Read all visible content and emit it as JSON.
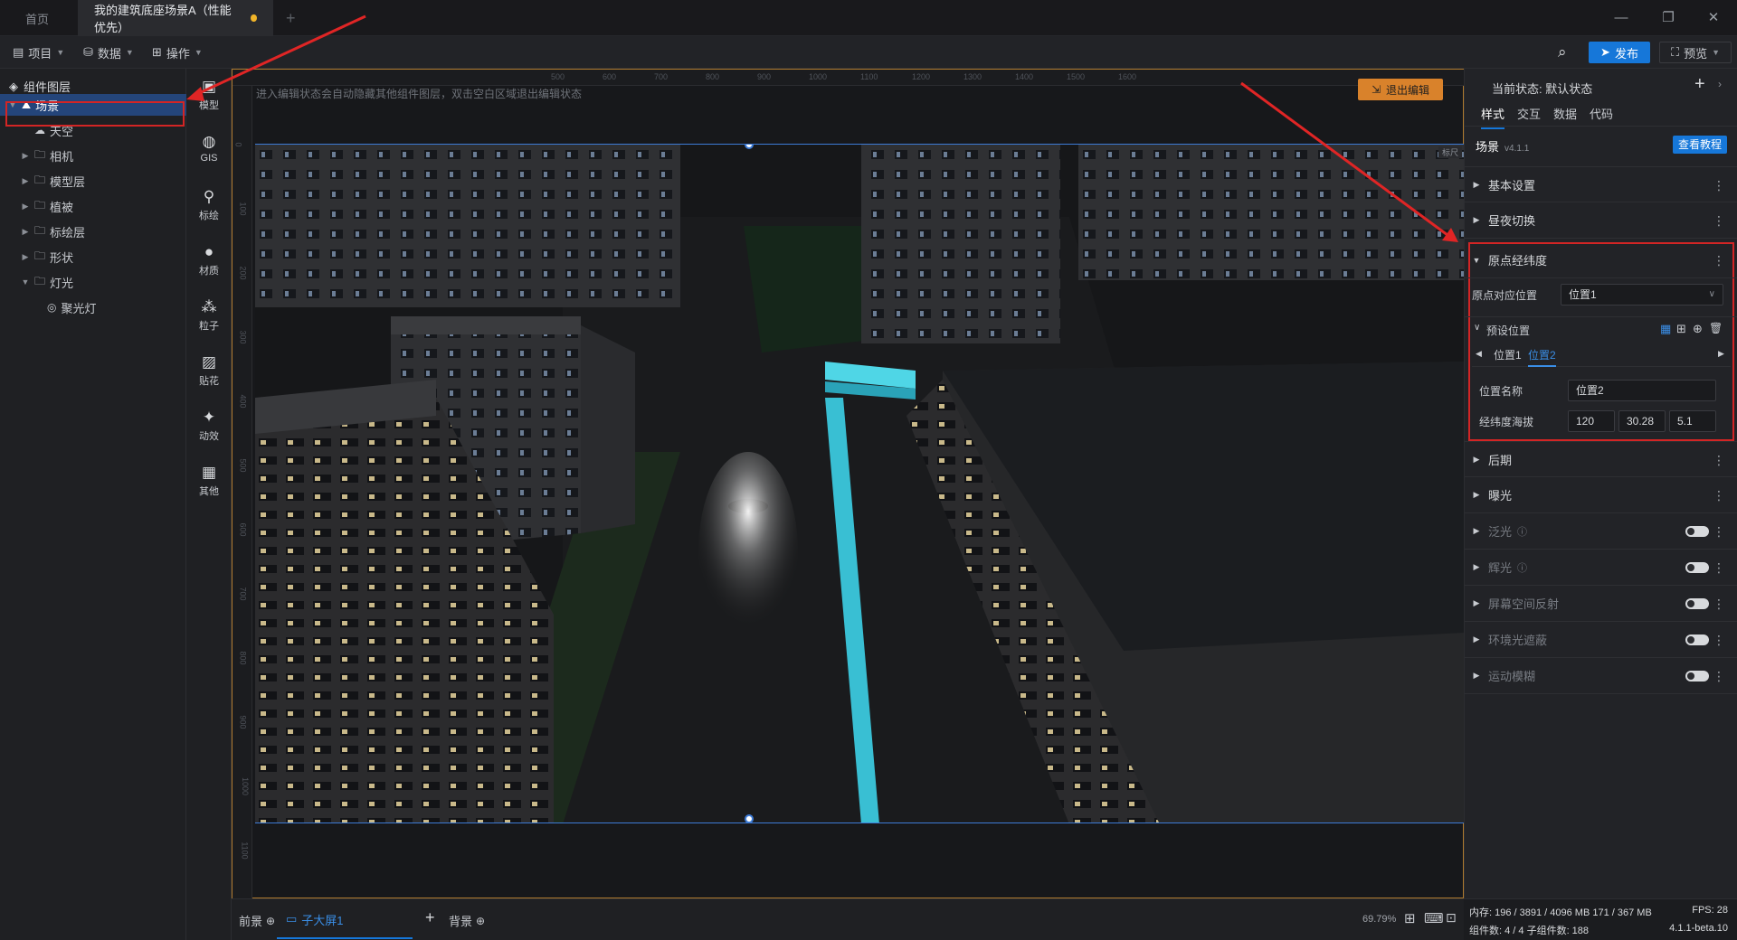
{
  "tabs": {
    "home": "首页",
    "active": "我的建筑底座场景A（性能优先）",
    "new_tab": "+"
  },
  "menubar": {
    "project": "项目",
    "data": "数据",
    "operate": "操作",
    "publish": "发布",
    "preview": "预览"
  },
  "layers": {
    "title": "组件图层",
    "items": [
      {
        "label": "场景",
        "icon": "scene-icon",
        "depth": 0,
        "expanded": true,
        "selected": true
      },
      {
        "label": "天空",
        "icon": "sky-icon",
        "depth": 1
      },
      {
        "label": "相机",
        "icon": "folder-icon",
        "depth": 1,
        "expandable": true
      },
      {
        "label": "模型层",
        "icon": "folder-icon",
        "depth": 1,
        "expandable": true
      },
      {
        "label": "植被",
        "icon": "folder-icon",
        "depth": 1,
        "expandable": true
      },
      {
        "label": "标绘层",
        "icon": "folder-icon",
        "depth": 1,
        "expandable": true
      },
      {
        "label": "形状",
        "icon": "folder-icon",
        "depth": 1,
        "expandable": true
      },
      {
        "label": "灯光",
        "icon": "folder-icon",
        "depth": 1,
        "expanded": true
      },
      {
        "label": "聚光灯",
        "icon": "spotlight-icon",
        "depth": 2
      }
    ]
  },
  "tools": [
    {
      "label": "模型",
      "icon": "model-icon"
    },
    {
      "label": "GIS",
      "icon": "globe-icon"
    },
    {
      "label": "标绘",
      "icon": "pin-icon"
    },
    {
      "label": "材质",
      "icon": "material-icon"
    },
    {
      "label": "粒子",
      "icon": "particle-icon"
    },
    {
      "label": "贴花",
      "icon": "decal-icon"
    },
    {
      "label": "动效",
      "icon": "effect-icon"
    },
    {
      "label": "其他",
      "icon": "grid-icon"
    }
  ],
  "canvas": {
    "hint": "进入编辑状态会自动隐藏其他组件图层，双击空白区域退出编辑状态",
    "exit_edit": "退出编辑",
    "ruler_top": [
      "500",
      "600",
      "700",
      "800",
      "900",
      "1000",
      "1100",
      "1200",
      "1300",
      "1400",
      "1500",
      "1600"
    ],
    "ruler_left": [
      "0",
      "100",
      "200",
      "300",
      "400",
      "500",
      "600",
      "700",
      "800",
      "900",
      "1000",
      "1100"
    ],
    "corner_tag": "标尺"
  },
  "bottom": {
    "front": "前景",
    "screen": "子大屏1",
    "add": "+",
    "background": "背景",
    "zoom": "69.79%"
  },
  "right": {
    "state_label": "当前状态: 默认状态",
    "tabs": [
      "样式",
      "交互",
      "数据",
      "代码"
    ],
    "component_name": "场景",
    "version": "v4.1.1",
    "tutorial": "查看教程",
    "sections": {
      "basic": "基本设置",
      "daynight": "昼夜切换",
      "origin": "原点经纬度",
      "post": "后期",
      "exposure": "曝光",
      "bloom": "泛光",
      "glow": "辉光",
      "ssr": "屏幕空间反射",
      "ao": "环境光遮蔽",
      "motion_blur": "运动模糊"
    },
    "origin": {
      "field_label": "原点对应位置",
      "field_value": "位置1",
      "preset_label": "预设位置",
      "preset_tabs": [
        "位置1",
        "位置2"
      ],
      "name_label": "位置名称",
      "name_value": "位置2",
      "lnglat_label": "经纬度海拔",
      "lng": "120",
      "lat": "30.28",
      "alt": "5.1"
    }
  },
  "status": {
    "memory": "内存:  196 / 3891 / 4096 MB  171 / 367 MB",
    "fps": "FPS:  28",
    "components": "组件数: 4 / 4    子组件数: 188",
    "version": "4.1.1-beta.10"
  }
}
